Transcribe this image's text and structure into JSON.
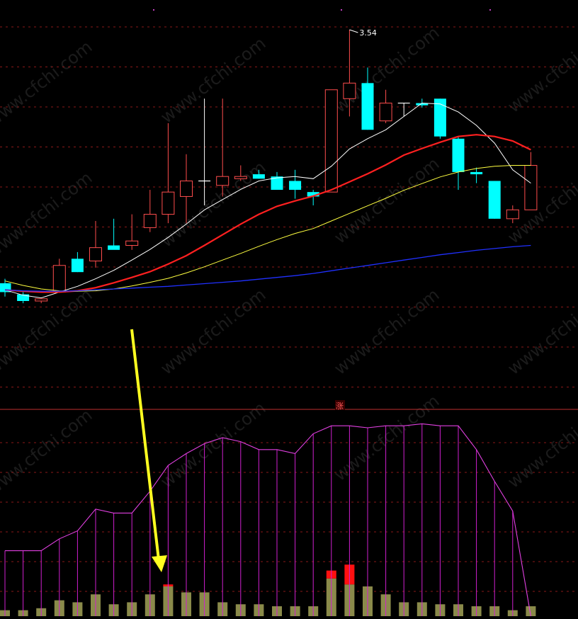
{
  "chart_data": [
    {
      "type": "candlestick",
      "title": "",
      "peak_label": "3.54",
      "y_unit": "price",
      "ylim": [
        2.72,
        3.58
      ],
      "gridlines": "dashed-red",
      "colors": {
        "up": "#ff4d4d",
        "down": "#00ffff",
        "ma5": "#ffffff",
        "ma10": "#ff2020",
        "ma20": "#ffff40",
        "ma60": "#2030ff",
        "arrow": "#ffff20"
      },
      "candles": [
        {
          "o": 2.975,
          "h": 2.985,
          "l": 2.945,
          "c": 2.955
        },
        {
          "o": 2.95,
          "h": 2.955,
          "l": 2.93,
          "c": 2.935
        },
        {
          "o": 2.935,
          "h": 2.94,
          "l": 2.93,
          "c": 2.94
        },
        {
          "o": 2.955,
          "h": 3.03,
          "l": 2.955,
          "c": 3.015
        },
        {
          "o": 3.03,
          "h": 3.045,
          "l": 3.0,
          "c": 3.0
        },
        {
          "o": 3.025,
          "h": 3.115,
          "l": 3.01,
          "c": 3.055
        },
        {
          "o": 3.06,
          "h": 3.12,
          "l": 3.055,
          "c": 3.05
        },
        {
          "o": 3.06,
          "h": 3.13,
          "l": 3.05,
          "c": 3.07
        },
        {
          "o": 3.1,
          "h": 3.185,
          "l": 3.09,
          "c": 3.13
        },
        {
          "o": 3.13,
          "h": 3.335,
          "l": 3.11,
          "c": 3.18
        },
        {
          "o": 3.17,
          "h": 3.265,
          "l": 3.11,
          "c": 3.205
        },
        {
          "o": 3.205,
          "h": 3.39,
          "l": 3.15,
          "c": 3.205
        },
        {
          "o": 3.195,
          "h": 3.39,
          "l": 3.17,
          "c": 3.215
        },
        {
          "o": 3.21,
          "h": 3.24,
          "l": 3.205,
          "c": 3.215
        },
        {
          "o": 3.22,
          "h": 3.23,
          "l": 3.21,
          "c": 3.21
        },
        {
          "o": 3.215,
          "h": 3.225,
          "l": 3.19,
          "c": 3.185
        },
        {
          "o": 3.205,
          "h": 3.23,
          "l": 3.165,
          "c": 3.185
        },
        {
          "o": 3.18,
          "h": 3.185,
          "l": 3.15,
          "c": 3.17
        },
        {
          "o": 3.18,
          "h": 3.41,
          "l": 3.18,
          "c": 3.41
        },
        {
          "o": 3.39,
          "h": 3.545,
          "l": 3.35,
          "c": 3.425
        },
        {
          "o": 3.425,
          "h": 3.46,
          "l": 3.32,
          "c": 3.32
        },
        {
          "o": 3.34,
          "h": 3.41,
          "l": 3.335,
          "c": 3.38
        },
        {
          "o": 3.38,
          "h": 3.38,
          "l": 3.35,
          "c": 3.38
        },
        {
          "o": 3.38,
          "h": 3.39,
          "l": 3.37,
          "c": 3.375
        },
        {
          "o": 3.39,
          "h": 3.39,
          "l": 3.3,
          "c": 3.305
        },
        {
          "o": 3.3,
          "h": 3.305,
          "l": 3.185,
          "c": 3.225
        },
        {
          "o": 3.225,
          "h": 3.235,
          "l": 3.2,
          "c": 3.22
        },
        {
          "o": 3.205,
          "h": 3.205,
          "l": 3.12,
          "c": 3.12
        },
        {
          "o": 3.12,
          "h": 3.15,
          "l": 3.11,
          "c": 3.14
        },
        {
          "o": 3.14,
          "h": 3.27,
          "l": 3.14,
          "c": 3.24
        }
      ],
      "series": [
        {
          "name": "",
          "values": [
            2.96,
            2.948,
            2.942,
            2.955,
            2.968,
            2.985,
            3.004,
            3.027,
            3.051,
            3.078,
            3.108,
            3.14,
            3.163,
            3.186,
            3.205,
            3.212,
            3.215,
            3.21,
            3.238,
            3.277,
            3.3,
            3.32,
            3.35,
            3.38,
            3.378,
            3.36,
            3.33,
            3.29,
            3.23,
            3.2
          ]
        },
        {
          "name": "",
          "values": [
            2.96,
            2.957,
            2.955,
            2.955,
            2.958,
            2.965,
            2.976,
            2.988,
            3.001,
            3.018,
            3.037,
            3.06,
            3.084,
            3.108,
            3.13,
            3.148,
            3.16,
            3.171,
            3.185,
            3.203,
            3.221,
            3.241,
            3.263,
            3.278,
            3.292,
            3.305,
            3.309,
            3.305,
            3.295,
            3.275
          ]
        },
        {
          "name": "",
          "values": [
            2.98,
            2.97,
            2.962,
            2.958,
            2.957,
            2.958,
            2.962,
            2.969,
            2.977,
            2.986,
            2.998,
            3.012,
            3.027,
            3.042,
            3.058,
            3.073,
            3.087,
            3.098,
            3.115,
            3.132,
            3.149,
            3.166,
            3.184,
            3.199,
            3.214,
            3.225,
            3.233,
            3.238,
            3.24,
            3.24
          ]
        },
        {
          "name": "",
          "values": [
            2.96,
            2.958,
            2.957,
            2.957,
            2.958,
            2.96,
            2.962,
            2.964,
            2.966,
            2.968,
            2.971,
            2.974,
            2.977,
            2.98,
            2.984,
            2.988,
            2.992,
            2.997,
            3.003,
            3.009,
            3.015,
            3.021,
            3.027,
            3.033,
            3.039,
            3.044,
            3.049,
            3.053,
            3.057,
            3.06
          ]
        }
      ]
    },
    {
      "type": "bar",
      "title": "",
      "tag": "涨",
      "ylim": [
        0,
        100
      ],
      "line_values": [
        33,
        33,
        33,
        39,
        43,
        54,
        52,
        52,
        63,
        76,
        82,
        87,
        90,
        88,
        84,
        84,
        82,
        92,
        96,
        96,
        95,
        96,
        96,
        97,
        96,
        96,
        84,
        68,
        53,
        0
      ],
      "bar_values": [
        3,
        3,
        4,
        8,
        7,
        11,
        6,
        7,
        11,
        15,
        12,
        12,
        7,
        6,
        6,
        5,
        5,
        5,
        19,
        16,
        15,
        11,
        7,
        7,
        6,
        6,
        5,
        5,
        3,
        5
      ],
      "red_bar_values": [
        0,
        0,
        0,
        0,
        0,
        0,
        0,
        0,
        0,
        1,
        0,
        0,
        0,
        0,
        0,
        0,
        0,
        0,
        4,
        10,
        0,
        0,
        0,
        0,
        0,
        0,
        0,
        0,
        0,
        0
      ]
    }
  ],
  "watermark": "www.cfchi.com"
}
